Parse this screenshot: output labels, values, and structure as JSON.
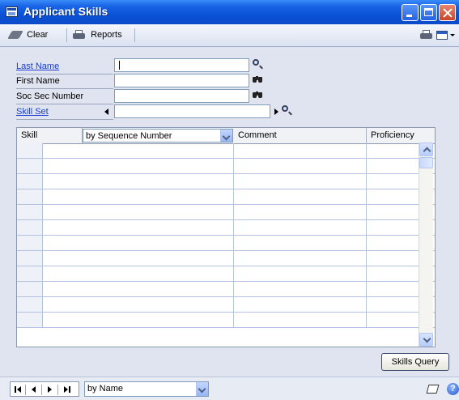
{
  "window": {
    "title": "Applicant Skills"
  },
  "toolbar": {
    "clear_label": "Clear",
    "reports_label": "Reports"
  },
  "form": {
    "last_name_label": "Last Name",
    "last_name_value": "",
    "first_name_label": "First Name",
    "first_name_value": "",
    "ssn_label": "Soc Sec Number",
    "ssn_value": "",
    "skill_set_label": "Skill Set",
    "skill_set_value": ""
  },
  "grid": {
    "columns": {
      "skill": "Skill",
      "sort": "by Sequence Number",
      "comment": "Comment",
      "proficiency": "Proficiency"
    },
    "row_count": 12
  },
  "buttons": {
    "skills_query": "Skills Query"
  },
  "statusbar": {
    "sort_by": "by Name"
  }
}
